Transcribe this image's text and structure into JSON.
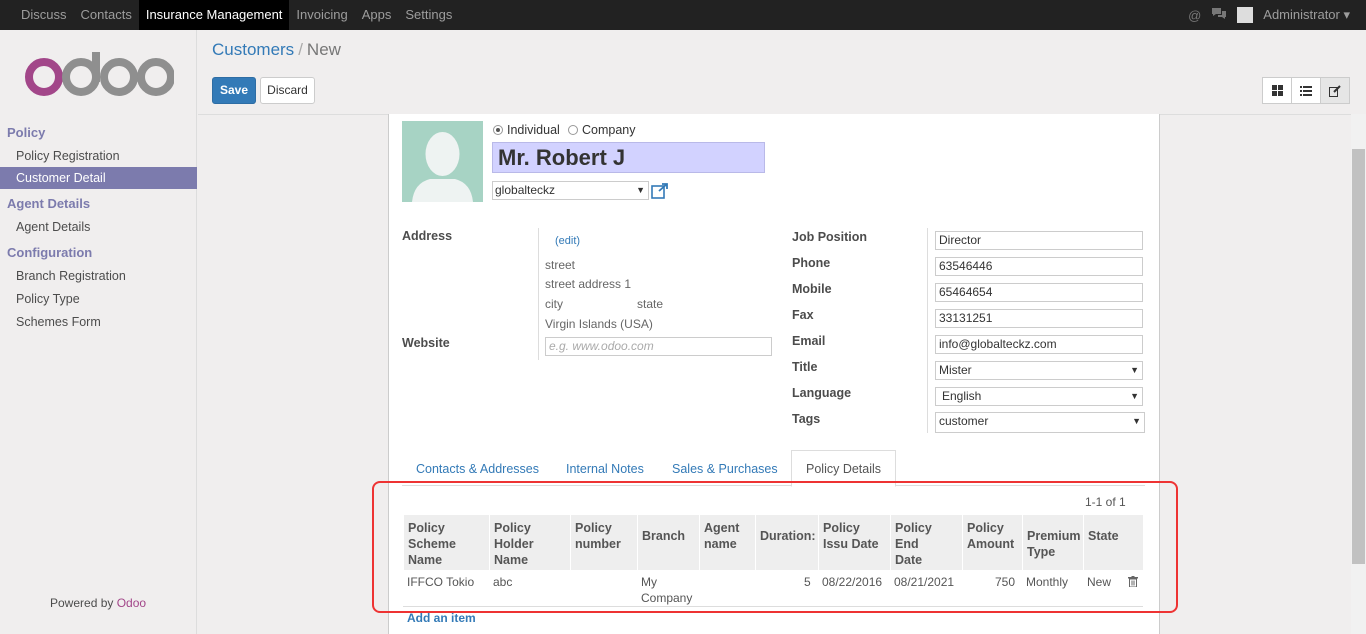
{
  "topbar": {
    "menu": [
      "Discuss",
      "Contacts",
      "Insurance Management",
      "Invoicing",
      "Apps",
      "Settings"
    ],
    "active": "Insurance Management",
    "user": "Administrator"
  },
  "sidebar": {
    "sections": [
      {
        "title": "Policy",
        "items": [
          "Policy Registration",
          "Customer Detail"
        ]
      },
      {
        "title": "Agent Details",
        "items": [
          "Agent Details"
        ]
      },
      {
        "title": "Configuration",
        "items": [
          "Branch Registration",
          "Policy Type",
          "Schemes Form"
        ]
      }
    ],
    "active_item": "Customer Detail",
    "powered_prefix": "Powered by",
    "powered_brand": "Odoo"
  },
  "breadcrumb": {
    "parent": "Customers",
    "current": "New"
  },
  "buttons": {
    "save": "Save",
    "discard": "Discard"
  },
  "form": {
    "type_individual": "Individual",
    "type_company": "Company",
    "name": "Mr. Robert J",
    "company": "globalteckz",
    "address_label": "Address",
    "edit_link": "(edit)",
    "street": "street",
    "street2": "street address 1",
    "city": "city",
    "state": "state",
    "country": "Virgin Islands (USA)",
    "website_label": "Website",
    "website_placeholder": "e.g. www.odoo.com",
    "fields": {
      "job_position": {
        "label": "Job Position",
        "value": "Director"
      },
      "phone": {
        "label": "Phone",
        "value": "63546446"
      },
      "mobile": {
        "label": "Mobile",
        "value": "65464654"
      },
      "fax": {
        "label": "Fax",
        "value": "33131251"
      },
      "email": {
        "label": "Email",
        "value": "info@globalteckz.com"
      },
      "title": {
        "label": "Title",
        "value": "Mister"
      },
      "language": {
        "label": "Language",
        "value": "English"
      },
      "tags": {
        "label": "Tags",
        "value": "customer"
      }
    }
  },
  "tabs": [
    "Contacts & Addresses",
    "Internal Notes",
    "Sales & Purchases",
    "Policy Details"
  ],
  "active_tab": "Policy Details",
  "policy_table": {
    "pager": "1-1 of 1",
    "headers": [
      "Policy\nScheme\nName",
      "Policy\nHolder\nName",
      "Policy\nnumber",
      "Branch",
      "Agent\nname",
      "Duration:",
      "Policy\nIssu Date",
      "Policy End\nDate",
      "Policy\nAmount",
      "Premium\nType",
      "State"
    ],
    "row": {
      "scheme": "IFFCO Tokio",
      "holder": "abc",
      "number": "",
      "branch": "My\nCompany",
      "agent": "",
      "duration": "5",
      "issue_date": "08/22/2016",
      "end_date": "08/21/2021",
      "amount": "750",
      "premium_type": "Monthly",
      "state": "New"
    },
    "add_item": "Add an item"
  },
  "colors": {
    "accent": "#7c7bad",
    "link": "#337ab7",
    "save": "#337ab7",
    "highlight": "#e33333"
  }
}
